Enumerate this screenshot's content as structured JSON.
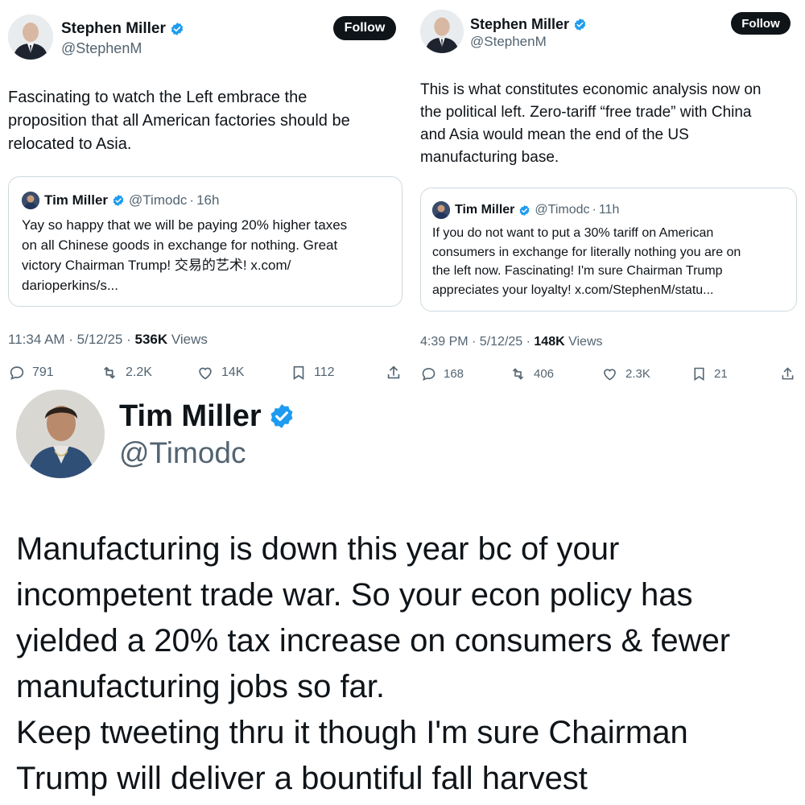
{
  "tweet_left": {
    "author": {
      "name": "Stephen Miller",
      "handle": "@StephenM"
    },
    "follow_label": "Follow",
    "text": "Fascinating to watch the Left embrace the\nproposition that all American factories should be\nrelocated to Asia.",
    "quote": {
      "name": "Tim Miller",
      "handle": "@Timodc",
      "time": "16h",
      "text": "Yay so happy that we will be paying 20% higher taxes\non all Chinese goods in exchange for nothing. Great\nvictory Chairman Trump! 交易的艺术! x.com/\ndarioperkins/s..."
    },
    "timestamp": "11:34 AM · 5/12/25 · ",
    "views_count": "536K",
    "views_label": " Views",
    "stats": {
      "replies": "791",
      "reposts": "2.2K",
      "likes": "14K",
      "bookmarks": "112"
    }
  },
  "tweet_right": {
    "author": {
      "name": "Stephen Miller",
      "handle": "@StephenM"
    },
    "follow_label": "Follow",
    "text": "This is what constitutes economic analysis now on\nthe political left. Zero-tariff “free trade” with China\nand Asia would mean the end of the US\nmanufacturing base.",
    "quote": {
      "name": "Tim Miller",
      "handle": "@Timodc",
      "time": "11h",
      "text": "If you do not want to put a 30% tariff on American\nconsumers in exchange for literally nothing you are on\nthe left now. Fascinating! I'm sure Chairman Trump\nappreciates your loyalty! x.com/StephenM/statu..."
    },
    "timestamp": "4:39 PM · 5/12/25 · ",
    "views_count": "148K",
    "views_label": " Views",
    "stats": {
      "replies": "168",
      "reposts": "406",
      "likes": "2.3K",
      "bookmarks": "21"
    }
  },
  "tweet_big": {
    "author": {
      "name": "Tim Miller",
      "handle": "@Timodc"
    },
    "text": "Manufacturing is down this year bc of your\nincompetent trade war. So your econ policy has\nyielded a 20% tax increase on consumers & fewer\nmanufacturing jobs so far.\nKeep tweeting thru it though I'm sure Chairman\nTrump will deliver a bountiful fall harvest"
  },
  "colors": {
    "verified": "#1d9bf0",
    "text_primary": "#0f1419",
    "text_secondary": "#536471",
    "border": "#cfd9de",
    "follow_bg": "#0f1419"
  },
  "icons": {
    "reply": "reply-icon",
    "repost": "repost-icon",
    "like": "heart-icon",
    "bookmark": "bookmark-icon",
    "share": "share-icon",
    "verified": "verified-badge-icon"
  },
  "separator": "·"
}
